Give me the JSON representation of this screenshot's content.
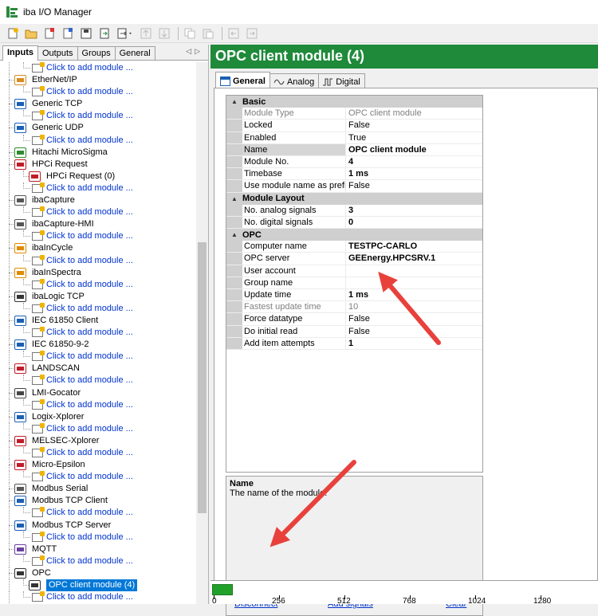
{
  "window": {
    "title": "iba I/O Manager"
  },
  "left_tabs": [
    "Inputs",
    "Outputs",
    "Groups",
    "General"
  ],
  "tree": [
    {
      "type": "add",
      "label": "Click to add module ..."
    },
    {
      "type": "group",
      "label": "EtherNet/IP",
      "icon": "ethernet-ip-icon",
      "color": "#d98b1f"
    },
    {
      "type": "add",
      "label": "Click to add module ..."
    },
    {
      "type": "group",
      "label": "Generic TCP",
      "icon": "tcp-icon",
      "color": "#1a5fb4"
    },
    {
      "type": "add",
      "label": "Click to add module ..."
    },
    {
      "type": "group",
      "label": "Generic UDP",
      "icon": "udp-icon",
      "color": "#1a5fb4"
    },
    {
      "type": "add",
      "label": "Click to add module ..."
    },
    {
      "type": "group",
      "label": "Hitachi MicroSigma",
      "icon": "hitachi-icon",
      "color": "#2e8b2e"
    },
    {
      "type": "group",
      "label": "HPCi Request",
      "icon": "hpci-icon",
      "color": "#c01c28"
    },
    {
      "type": "module",
      "label": "HPCi Request (0)",
      "icon": "hpci-module-icon",
      "color": "#c01c28"
    },
    {
      "type": "add",
      "label": "Click to add module ..."
    },
    {
      "type": "group",
      "label": "ibaCapture",
      "icon": "camera-icon",
      "color": "#555555"
    },
    {
      "type": "add",
      "label": "Click to add module ..."
    },
    {
      "type": "group",
      "label": "ibaCapture-HMI",
      "icon": "hmi-icon",
      "color": "#555555"
    },
    {
      "type": "add",
      "label": "Click to add module ..."
    },
    {
      "type": "group",
      "label": "ibaInCycle",
      "icon": "incycle-icon",
      "color": "#e08a00"
    },
    {
      "type": "add",
      "label": "Click to add module ..."
    },
    {
      "type": "group",
      "label": "ibaInSpectra",
      "icon": "inspectra-icon",
      "color": "#e08a00"
    },
    {
      "type": "add",
      "label": "Click to add module ..."
    },
    {
      "type": "group",
      "label": "ibaLogic TCP",
      "icon": "logic-icon",
      "color": "#333333"
    },
    {
      "type": "add",
      "label": "Click to add module ..."
    },
    {
      "type": "group",
      "label": "IEC 61850 Client",
      "icon": "iec61850-icon",
      "color": "#1a5fb4"
    },
    {
      "type": "add",
      "label": "Click to add module ..."
    },
    {
      "type": "group",
      "label": "IEC 61850-9-2",
      "icon": "sv-icon",
      "color": "#1a5fb4"
    },
    {
      "type": "add",
      "label": "Click to add module ..."
    },
    {
      "type": "group",
      "label": "LANDSCAN",
      "icon": "landscan-icon",
      "color": "#c01c28"
    },
    {
      "type": "add",
      "label": "Click to add module ..."
    },
    {
      "type": "group",
      "label": "LMI-Gocator",
      "icon": "gocator-icon",
      "color": "#444444"
    },
    {
      "type": "add",
      "label": "Click to add module ..."
    },
    {
      "type": "group",
      "label": "Logix-Xplorer",
      "icon": "logix-icon",
      "color": "#1a5fb4"
    },
    {
      "type": "add",
      "label": "Click to add module ..."
    },
    {
      "type": "group",
      "label": "MELSEC-Xplorer",
      "icon": "melsec-icon",
      "color": "#c01c28"
    },
    {
      "type": "add",
      "label": "Click to add module ..."
    },
    {
      "type": "group",
      "label": "Micro-Epsilon",
      "icon": "micro-epsilon-icon",
      "color": "#c01c28"
    },
    {
      "type": "add",
      "label": "Click to add module ..."
    },
    {
      "type": "group",
      "label": "Modbus Serial",
      "icon": "modbus-serial-icon",
      "color": "#555555"
    },
    {
      "type": "group",
      "label": "Modbus TCP Client",
      "icon": "modbus-client-icon",
      "color": "#1a5fb4"
    },
    {
      "type": "add",
      "label": "Click to add module ..."
    },
    {
      "type": "group",
      "label": "Modbus TCP Server",
      "icon": "modbus-server-icon",
      "color": "#1a5fb4"
    },
    {
      "type": "add",
      "label": "Click to add module ..."
    },
    {
      "type": "group",
      "label": "MQTT",
      "icon": "mqtt-icon",
      "color": "#6a3ea1"
    },
    {
      "type": "add",
      "label": "Click to add module ..."
    },
    {
      "type": "group",
      "label": "OPC",
      "icon": "opc-icon",
      "color": "#333333"
    },
    {
      "type": "module",
      "label": "OPC client module (4)",
      "icon": "opc-module-icon",
      "color": "#333333",
      "selected": true
    },
    {
      "type": "add",
      "label": "Click to add module ..."
    }
  ],
  "module": {
    "title": "OPC client module (4)",
    "tabs": [
      "General",
      "Analog",
      "Digital"
    ]
  },
  "props": {
    "basic_label": "Basic",
    "layout_label": "Module Layout",
    "opc_label": "OPC",
    "basic": [
      {
        "name": "Module Type",
        "value": "OPC client module",
        "ro": true
      },
      {
        "name": "Locked",
        "value": "False"
      },
      {
        "name": "Enabled",
        "value": "True"
      },
      {
        "name": "Name",
        "value": "OPC client module",
        "bold": true,
        "sel": true
      },
      {
        "name": "Module No.",
        "value": "4",
        "bold": true
      },
      {
        "name": "Timebase",
        "value": "1 ms",
        "bold": true
      },
      {
        "name": "Use module name as prefix",
        "value": "False"
      }
    ],
    "layout": [
      {
        "name": "No. analog signals",
        "value": "3",
        "bold": true
      },
      {
        "name": "No. digital signals",
        "value": "0",
        "bold": true
      }
    ],
    "opc": [
      {
        "name": "Computer name",
        "value": "TESTPC-CARLO",
        "bold": true
      },
      {
        "name": "OPC server",
        "value": "GEEnergy.HPCSRV.1",
        "bold": true
      },
      {
        "name": "User account",
        "value": ""
      },
      {
        "name": "Group name",
        "value": ""
      },
      {
        "name": "Update time",
        "value": "1 ms",
        "bold": true
      },
      {
        "name": "Fastest update time",
        "value": "10",
        "ro": true
      },
      {
        "name": "Force datatype",
        "value": "False"
      },
      {
        "name": "Do initial read",
        "value": "False"
      },
      {
        "name": "Add item attempts",
        "value": "1",
        "bold": true
      }
    ]
  },
  "description": {
    "title": "Name",
    "text": "The name of the module."
  },
  "links": {
    "disconnect": "Disconnect",
    "add_signals": "Add signals",
    "clear": "Clear"
  },
  "ruler": {
    "ticks": [
      "0",
      "256",
      "512",
      "768",
      "1024",
      "1280"
    ]
  },
  "colors": {
    "header_green": "#1e8a3a",
    "selection_blue": "#0078d7",
    "link_blue": "#0033cc",
    "arrow_red": "#e8413c"
  }
}
